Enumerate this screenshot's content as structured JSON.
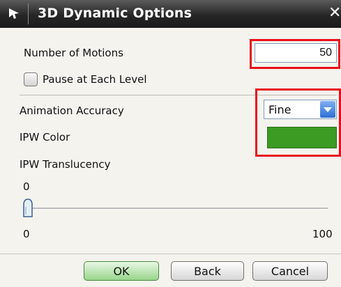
{
  "window": {
    "title": "3D Dynamic Options",
    "close_symbol": "✕",
    "title_icon": "cursor-arrow-icon"
  },
  "motions": {
    "label": "Number of Motions",
    "value": "50"
  },
  "pause": {
    "label": "Pause at Each Level",
    "checked": false
  },
  "accuracy": {
    "label": "Animation Accuracy",
    "value": "Fine"
  },
  "ipw_color": {
    "label": "IPW Color",
    "color": "#3b9b23"
  },
  "translucency": {
    "label": "IPW Translucency",
    "current": "0",
    "min": "0",
    "max": "100",
    "level": 0
  },
  "buttons": {
    "ok": "OK",
    "back": "Back",
    "cancel": "Cancel"
  },
  "colors": {
    "highlight": "#e8101a",
    "ok_accent": "#98d58b",
    "dropdown_accent": "#2f6fd4"
  }
}
